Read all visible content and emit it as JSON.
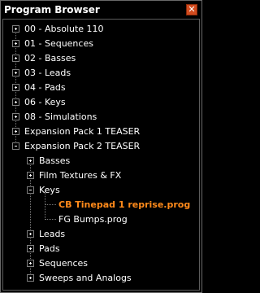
{
  "window": {
    "title": "Program Browser",
    "close_icon": "close-icon"
  },
  "tree": {
    "top_level": [
      {
        "label": "00 - Absolute 110",
        "state": "collapsed"
      },
      {
        "label": "01 - Sequences",
        "state": "collapsed"
      },
      {
        "label": "02 - Basses",
        "state": "collapsed"
      },
      {
        "label": "03 - Leads",
        "state": "collapsed"
      },
      {
        "label": "04 - Pads",
        "state": "collapsed"
      },
      {
        "label": "06 - Keys",
        "state": "collapsed"
      },
      {
        "label": "08 - Simulations",
        "state": "collapsed"
      },
      {
        "label": "Expansion Pack 1 TEASER",
        "state": "collapsed"
      },
      {
        "label": "Expansion Pack 2 TEASER",
        "state": "expanded"
      }
    ],
    "expansion_pack_2_children": [
      {
        "label": "Basses",
        "state": "collapsed"
      },
      {
        "label": "Film Textures & FX",
        "state": "collapsed"
      },
      {
        "label": "Keys",
        "state": "expanded"
      },
      {
        "label": "Leads",
        "state": "collapsed"
      },
      {
        "label": "Pads",
        "state": "collapsed"
      },
      {
        "label": "Sequences",
        "state": "collapsed"
      },
      {
        "label": "Sweeps and Analogs",
        "state": "collapsed"
      }
    ],
    "keys_children": [
      {
        "label": "CB Tinepad 1 reprise.prog",
        "selected": true
      },
      {
        "label": "FG Bumps.prog",
        "selected": false
      }
    ]
  },
  "colors": {
    "selected_text": "#ff8a1a",
    "close_button": "#d24b1e",
    "background": "#000000"
  }
}
